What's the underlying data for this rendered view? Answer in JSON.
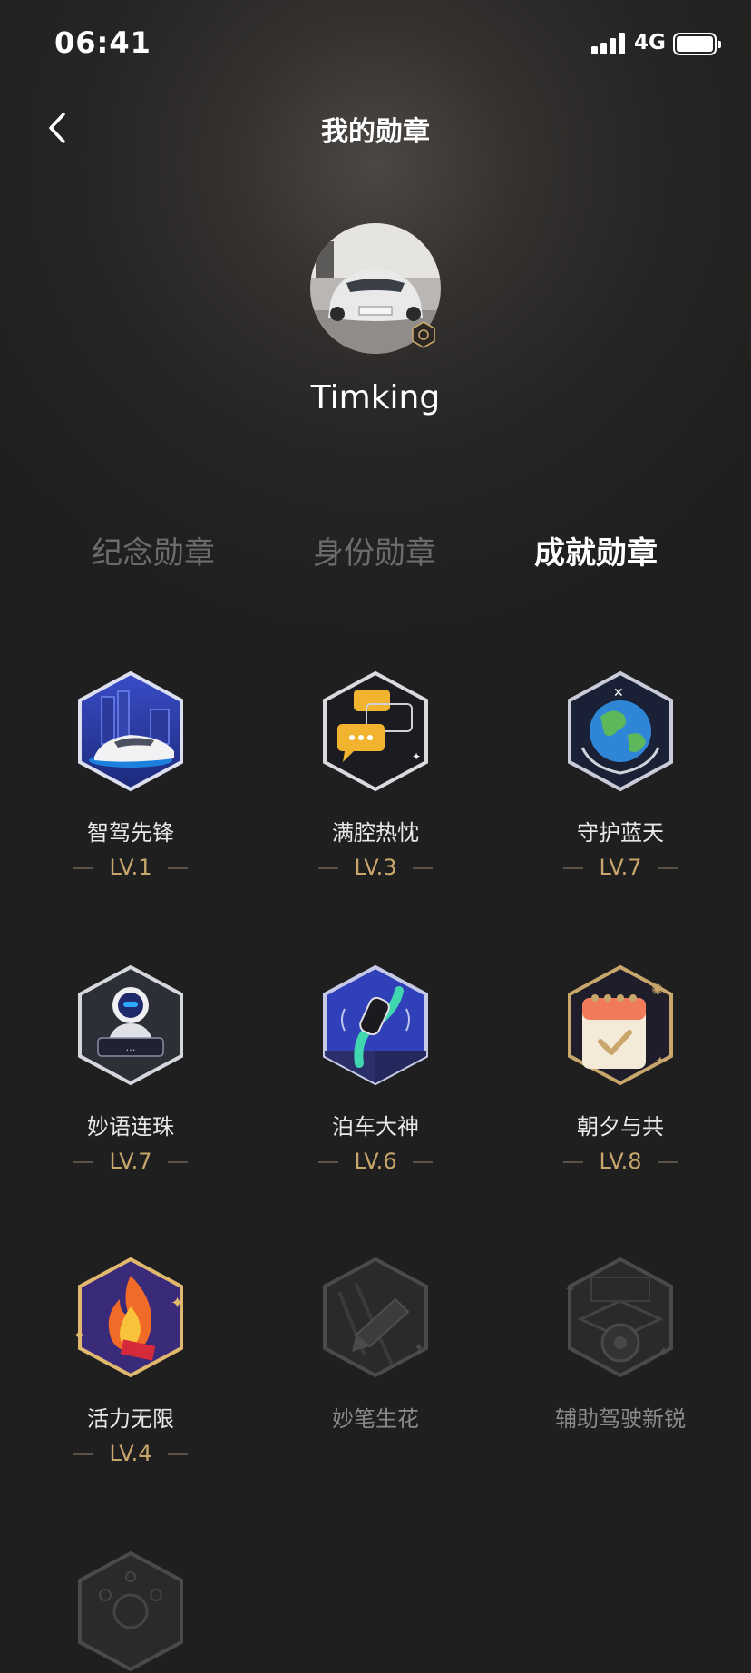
{
  "status_bar": {
    "time": "06:41",
    "network": "4G"
  },
  "header": {
    "title": "我的勋章"
  },
  "profile": {
    "username": "Timking"
  },
  "tabs": [
    {
      "label": "纪念勋章",
      "active": false
    },
    {
      "label": "身份勋章",
      "active": false
    },
    {
      "label": "成就勋章",
      "active": true
    }
  ],
  "badges": [
    {
      "name": "智驾先锋",
      "level": "LV.1",
      "icon": "autopilot-car-badge-icon"
    },
    {
      "name": "满腔热忱",
      "level": "LV.3",
      "icon": "chat-bubbles-badge-icon"
    },
    {
      "name": "守护蓝天",
      "level": "LV.7",
      "icon": "earth-hands-badge-icon"
    },
    {
      "name": "妙语连珠",
      "level": "LV.7",
      "icon": "voice-assistant-badge-icon"
    },
    {
      "name": "泊车大神",
      "level": "LV.6",
      "icon": "parking-badge-icon"
    },
    {
      "name": "朝夕与共",
      "level": "LV.8",
      "icon": "calendar-badge-icon"
    },
    {
      "name": "活力无限",
      "level": "LV.4",
      "icon": "flame-badge-icon"
    },
    {
      "name": "妙笔生花",
      "level": "",
      "icon": "pen-locked-badge-icon"
    },
    {
      "name": "辅助驾驶新锐",
      "level": "",
      "icon": "driving-locked-badge-icon"
    }
  ],
  "colors": {
    "background": "#1f1f1f",
    "accent_gold": "#c9a66b",
    "tab_inactive": "#6d6c6b"
  }
}
